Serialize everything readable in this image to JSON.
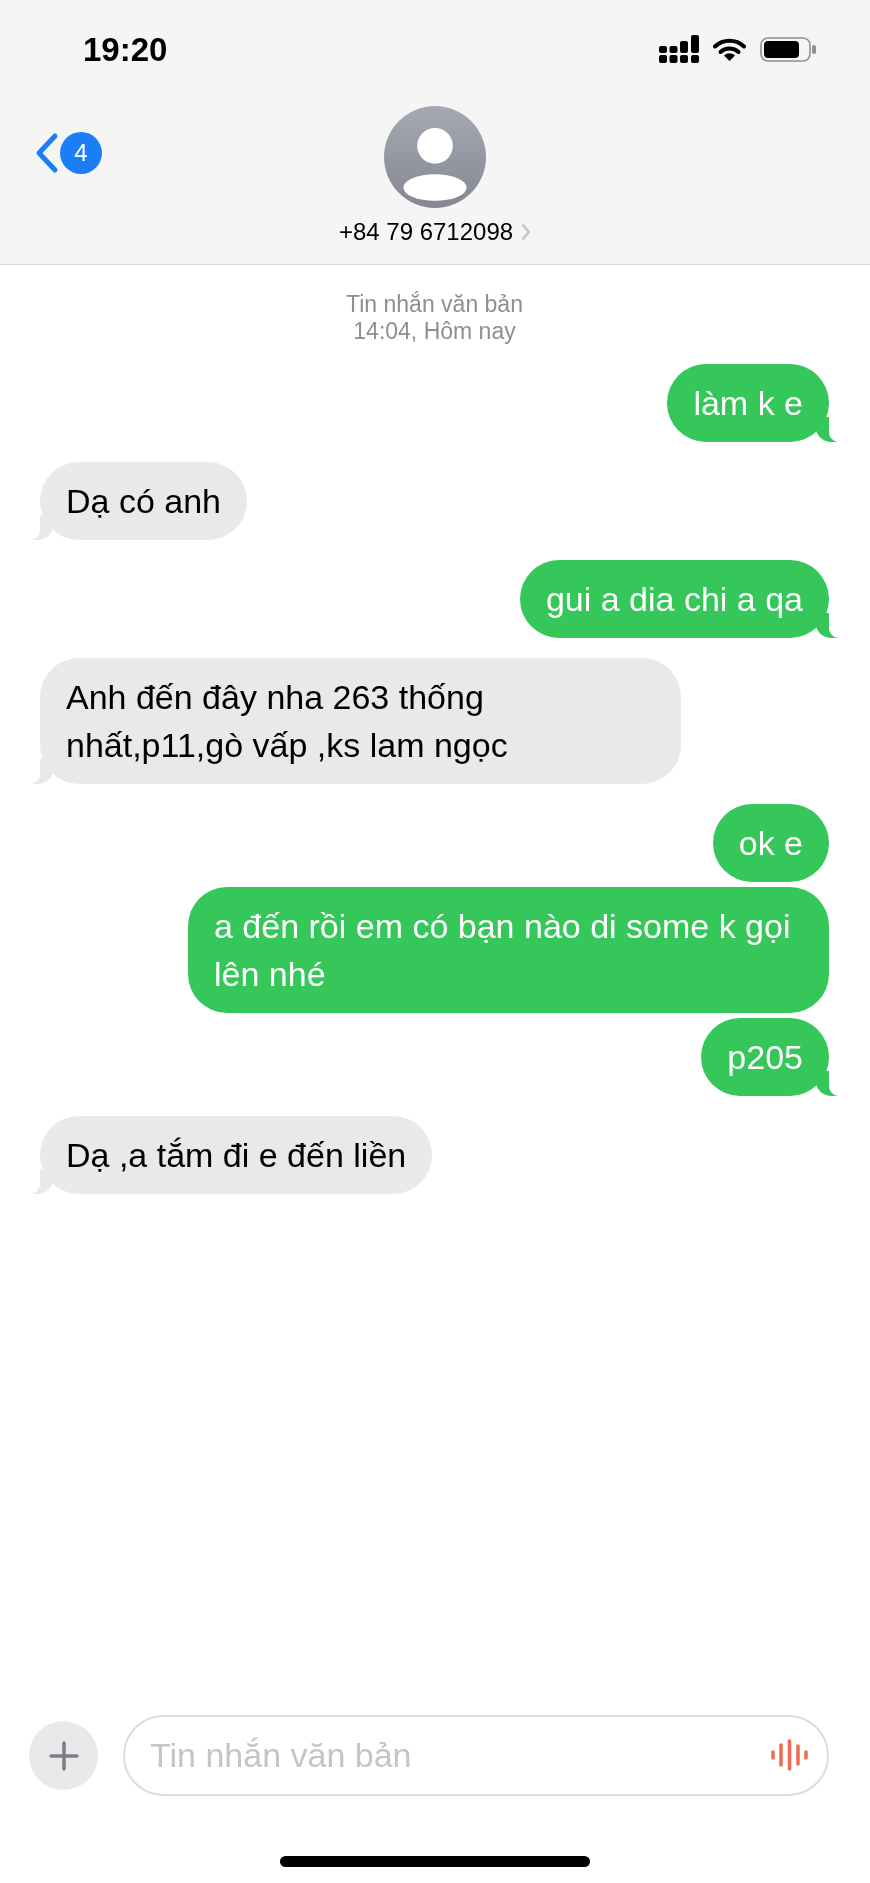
{
  "status_bar": {
    "time": "19:20"
  },
  "header": {
    "back_badge": "4",
    "contact": "+84 79 6712098"
  },
  "conversation": {
    "service_label": "Tin nhắn văn bản",
    "timestamp": "14:04, Hôm nay",
    "messages": [
      {
        "kind": "sent",
        "text": "làm k e",
        "tail": true
      },
      {
        "kind": "received",
        "text": "Dạ có anh",
        "tail": true
      },
      {
        "kind": "sent",
        "text": "gui a dia chi a qa",
        "tail": true
      },
      {
        "kind": "received",
        "text": "Anh đến đây nha 263 thống nhất,p11,gò vấp ,ks lam ngọc",
        "tail": true
      },
      {
        "kind": "sent",
        "text": "ok e",
        "tail": false
      },
      {
        "kind": "sent",
        "text": "a đến rồi em có bạn nào di some k gọi lên nhé",
        "tail": false
      },
      {
        "kind": "sent",
        "text": "p205",
        "tail": true
      },
      {
        "kind": "received",
        "text": "Dạ ,a tắm đi e đến liền",
        "tail": true
      }
    ]
  },
  "composer": {
    "placeholder": "Tin nhắn văn bản"
  }
}
